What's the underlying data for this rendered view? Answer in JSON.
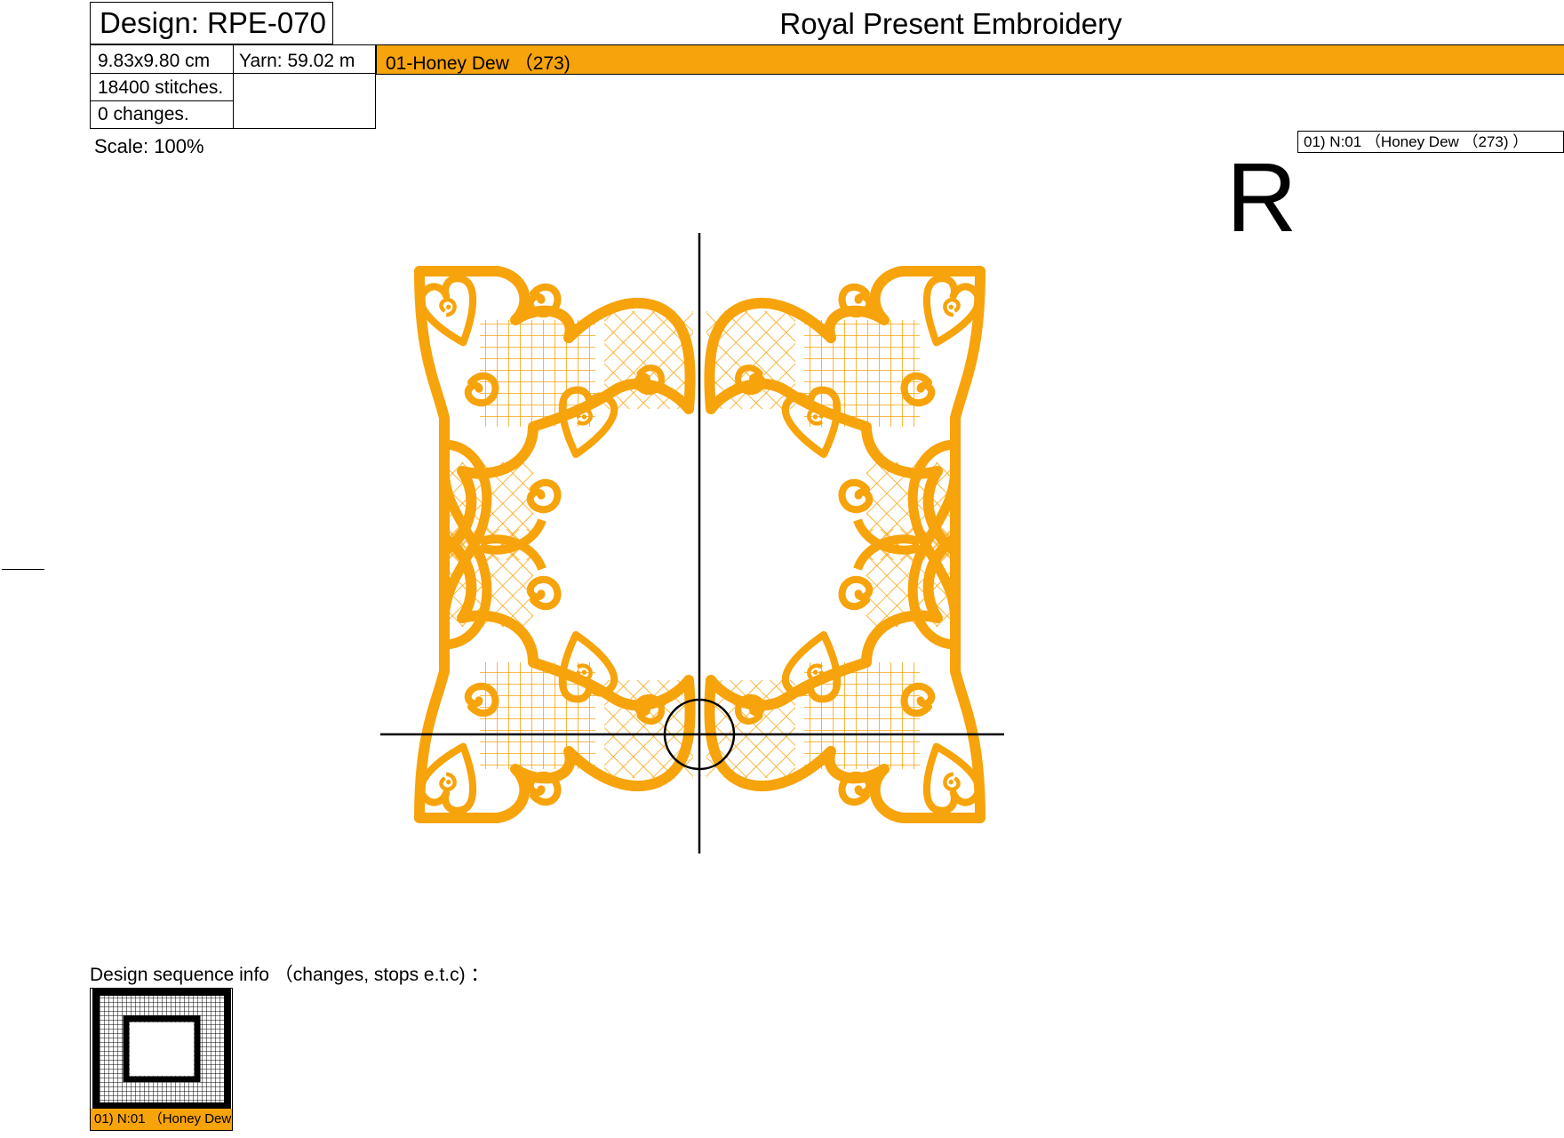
{
  "header": {
    "design_title": "Design: RPE-070",
    "company": "Royal Present Embroidery"
  },
  "info": {
    "size": "9.83x9.80 cm",
    "yarn": "Yarn: 59.02 m",
    "stitches": "18400 stitches.",
    "changes": "0 changes."
  },
  "color_bar": {
    "label": "01-Honey Dew （273)",
    "color": "#f7a30b"
  },
  "scale": "Scale: 100%",
  "legend": "01)   N:01 （Honey Dew （273) ）",
  "orientation_mark": "R",
  "sequence": {
    "label": "Design sequence info （changes, stops e.t.c) ：",
    "thumbnail_caption": "01)   N:01 （Honey Dew",
    "thumbnail_color": "#000000"
  },
  "design": {
    "thread_color": "#f7a30b"
  }
}
